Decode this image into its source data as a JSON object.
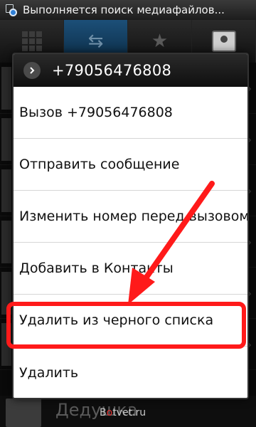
{
  "status_bar": {
    "text": "Выполняется поиск медиафайлов..."
  },
  "tabs": [
    {
      "icon": "dialpad-icon"
    },
    {
      "icon": "call-log-icon"
    },
    {
      "icon": "favorites-star-icon"
    },
    {
      "icon": "contacts-icon"
    }
  ],
  "background": {
    "contact_name": "Дедушка"
  },
  "dialog": {
    "title": "+79056476808",
    "items": [
      {
        "label": "Вызов +79056476808"
      },
      {
        "label": "Отправить сообщение"
      },
      {
        "label": "Изменить номер перед вызовом"
      },
      {
        "label": "Добавить в Контакты"
      },
      {
        "label": "Удалить из черного списка"
      },
      {
        "label": "Удалить"
      }
    ]
  },
  "annotation": {
    "highlight_color": "#ff1a1a"
  },
  "watermark": {
    "prefix": "B",
    "o": "o",
    "rest": "tvet.ru"
  }
}
